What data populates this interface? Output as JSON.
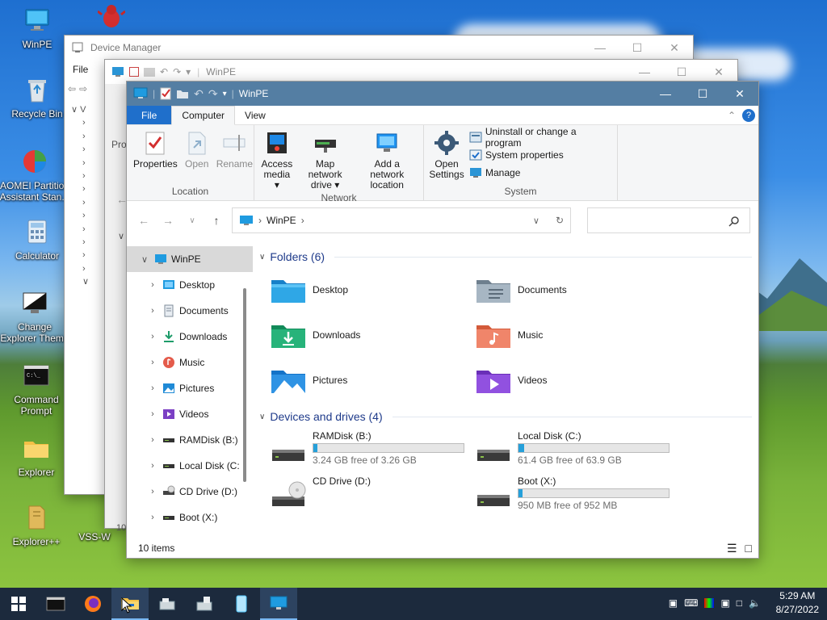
{
  "desktop": {
    "icons": [
      {
        "label": "WinPE",
        "icon": "computer-icon"
      },
      {
        "label": "",
        "icon": "bug-icon"
      },
      {
        "label": "Recycle Bin",
        "icon": "recycle-bin-icon"
      },
      {
        "label": "AOMEI Partition Assistant Stan...",
        "icon": "aomei-icon"
      },
      {
        "label": "Calculator",
        "icon": "calculator-icon"
      },
      {
        "label": "Change Explorer Theme",
        "icon": "theme-icon"
      },
      {
        "label": "Command Prompt",
        "icon": "cmd-icon"
      },
      {
        "label": "Explorer",
        "icon": "folder-icon"
      },
      {
        "label": "Explorer++",
        "icon": "explorerpp-icon"
      },
      {
        "label": "VSS-W",
        "icon": "vss-icon"
      }
    ]
  },
  "device_manager": {
    "title": "Device Manager",
    "menu_file": "File",
    "tree_label": "V"
  },
  "back_window": {
    "title": "WinPE",
    "label_pro": "Pro",
    "status_10": "10"
  },
  "explorer": {
    "title": "WinPE",
    "tabs": {
      "file": "File",
      "computer": "Computer",
      "view": "View"
    },
    "ribbon": {
      "location": {
        "label": "Location",
        "properties": "Properties",
        "open": "Open",
        "rename": "Rename"
      },
      "network": {
        "label": "Network",
        "access_media": "Access media",
        "map_drive": "Map network drive",
        "add_location": "Add a network location"
      },
      "system": {
        "label": "System",
        "open_settings": "Open Settings",
        "uninstall": "Uninstall or change a program",
        "system_properties": "System properties",
        "manage": "Manage"
      }
    },
    "address": {
      "path": "WinPE",
      "search_placeholder": ""
    },
    "nav_tree": [
      {
        "label": "WinPE",
        "icon": "computer-icon",
        "selected": true,
        "expanded": true
      },
      {
        "label": "Desktop",
        "icon": "desktop-icon"
      },
      {
        "label": "Documents",
        "icon": "documents-icon"
      },
      {
        "label": "Downloads",
        "icon": "downloads-icon"
      },
      {
        "label": "Music",
        "icon": "music-icon"
      },
      {
        "label": "Pictures",
        "icon": "pictures-icon"
      },
      {
        "label": "Videos",
        "icon": "videos-icon"
      },
      {
        "label": "RAMDisk (B:)",
        "icon": "drive-icon"
      },
      {
        "label": "Local Disk (C:",
        "icon": "drive-icon"
      },
      {
        "label": "CD Drive (D:)",
        "icon": "cd-drive-icon"
      },
      {
        "label": "Boot (X:)",
        "icon": "drive-icon"
      }
    ],
    "folders_header": "Folders (6)",
    "folders": [
      {
        "label": "Desktop",
        "icon": "desktop-folder-icon"
      },
      {
        "label": "Documents",
        "icon": "documents-folder-icon"
      },
      {
        "label": "Downloads",
        "icon": "downloads-folder-icon"
      },
      {
        "label": "Music",
        "icon": "music-folder-icon"
      },
      {
        "label": "Pictures",
        "icon": "pictures-folder-icon"
      },
      {
        "label": "Videos",
        "icon": "videos-folder-icon"
      }
    ],
    "drives_header": "Devices and drives (4)",
    "drives": [
      {
        "label": "RAMDisk (B:)",
        "free": "3.24 GB free of 3.26 GB",
        "used_fraction": 0.006,
        "bar": true
      },
      {
        "label": "Local Disk (C:)",
        "free": "61.4 GB free of 63.9 GB",
        "used_fraction": 0.04,
        "bar": true
      },
      {
        "label": "CD Drive (D:)",
        "free": "",
        "used_fraction": 0,
        "bar": false
      },
      {
        "label": "Boot (X:)",
        "free": "950 MB free of 952 MB",
        "used_fraction": 0.002,
        "bar": true
      }
    ],
    "status": "10 items"
  },
  "taskbar": {
    "time": "5:29 AM",
    "date": "8/27/2022"
  },
  "colors": {
    "accent": "#1f6fcb",
    "titlebar": "#547ea3",
    "bar_fill": "#26a0da",
    "group_header": "#1e3a8a"
  }
}
